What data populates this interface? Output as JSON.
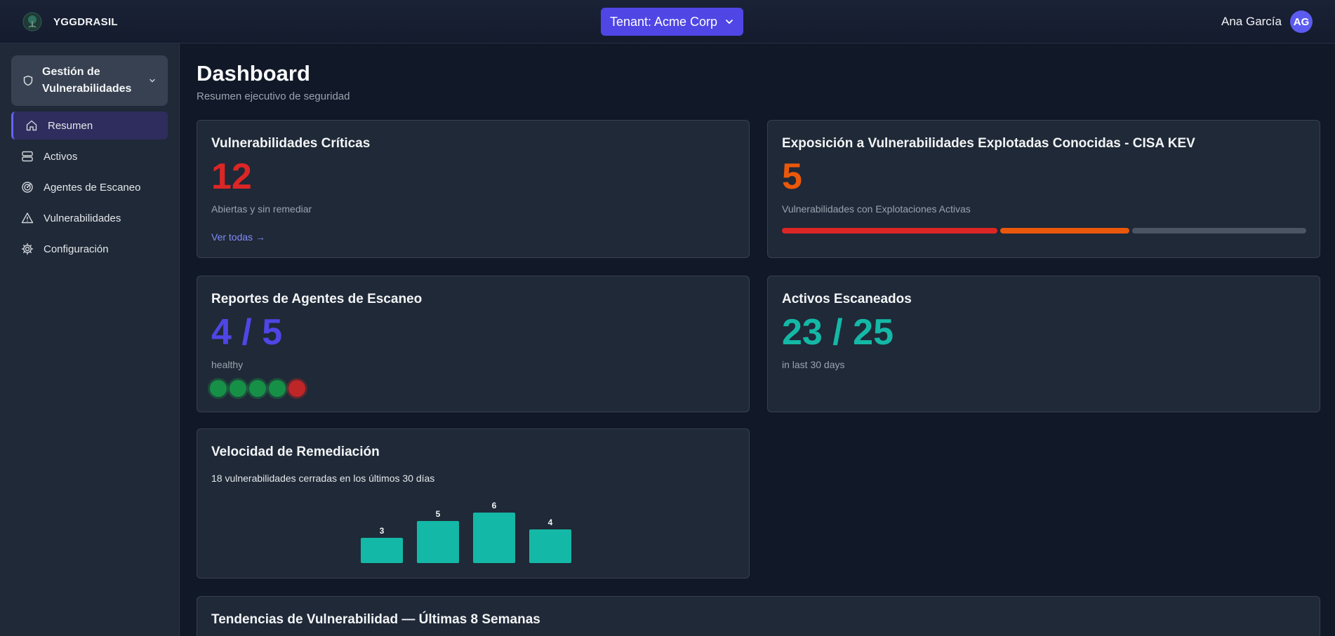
{
  "header": {
    "brand": "YGGDRASIL",
    "tenant_label": "Tenant: Acme Corp",
    "user_name": "Ana García",
    "user_initials": "AG"
  },
  "sidebar": {
    "module_label": "Gestión de Vulnerabilidades",
    "items": [
      {
        "label": "Resumen",
        "icon": "home-icon",
        "active": true
      },
      {
        "label": "Activos",
        "icon": "server-icon",
        "active": false
      },
      {
        "label": "Agentes de Escaneo",
        "icon": "radar-icon",
        "active": false
      },
      {
        "label": "Vulnerabilidades",
        "icon": "warning-icon",
        "active": false
      },
      {
        "label": "Configuración",
        "icon": "gear-icon",
        "active": false
      }
    ]
  },
  "page": {
    "title": "Dashboard",
    "subtitle": "Resumen ejecutivo de seguridad"
  },
  "cards": {
    "critical": {
      "title": "Vulnerabilidades Críticas",
      "value": "12",
      "caption": "Abiertas y sin remediar",
      "link": "Ver todas →",
      "color": "#dc2626"
    },
    "kev": {
      "title": "Exposición a Vulnerabilidades Explotadas Conocidas - CISA KEV",
      "value": "5",
      "caption": "Vulnerabilidades con Explotaciones Activas",
      "color": "#ea580c",
      "segments": [
        {
          "fraction": 0.415,
          "color": "#dc2626"
        },
        {
          "fraction": 0.25,
          "color": "#ea580c"
        },
        {
          "fraction": 0.335,
          "color": "#4b5563"
        }
      ]
    },
    "agents": {
      "title": "Reportes de Agentes de Escaneo",
      "value": "4 / 5",
      "caption": "healthy",
      "color": "#4f46e5",
      "statuses": [
        "ok",
        "ok",
        "ok",
        "ok",
        "bad"
      ]
    },
    "assets": {
      "title": "Activos Escaneados",
      "value": "23 / 25",
      "caption": "in last 30 days",
      "color": "#14b8a6"
    },
    "velocity": {
      "title": "Velocidad de Remediación",
      "caption": "18 vulnerabilidades cerradas en los últimos 30 días"
    },
    "trends": {
      "title": "Tendencias de Vulnerabilidad — Últimas 8 Semanas"
    }
  },
  "chart_data": {
    "type": "bar",
    "title": "",
    "xlabel": "",
    "ylabel": "",
    "categories": [
      "",
      "",
      "",
      ""
    ],
    "values": [
      3,
      5,
      6,
      4
    ],
    "color": "#14b8a6"
  }
}
